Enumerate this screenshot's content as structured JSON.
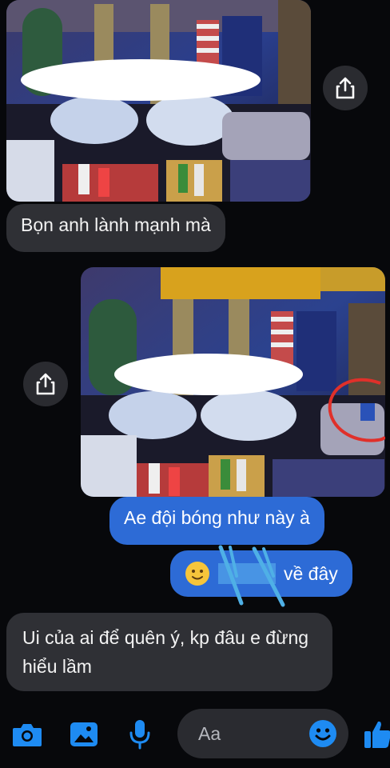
{
  "messages": [
    {
      "type": "image",
      "direction": "incoming",
      "description": "karaoke-room-photo"
    },
    {
      "type": "text",
      "direction": "incoming",
      "text": "Bọn anh lành mạnh mà"
    },
    {
      "type": "image",
      "direction": "outgoing",
      "description": "karaoke-room-photo-circled"
    },
    {
      "type": "text",
      "direction": "outgoing",
      "text": "Ae đội bóng như này à"
    },
    {
      "type": "text",
      "direction": "outgoing",
      "text": "về đây",
      "emoji": "slightly-smiling-face"
    },
    {
      "type": "text",
      "direction": "incoming",
      "text": "Ui của ai để quên ý, kp đâu e đừng hiểu lầm"
    }
  ],
  "composer": {
    "placeholder": "Aa",
    "icons": [
      "camera-icon",
      "gallery-icon",
      "microphone-icon",
      "emoji-icon",
      "thumbs-up-icon"
    ]
  },
  "colors": {
    "background": "#07080b",
    "incoming_bubble": "#2f3035",
    "outgoing_bubble": "#2d6bd6",
    "accent": "#1e8bf2"
  }
}
